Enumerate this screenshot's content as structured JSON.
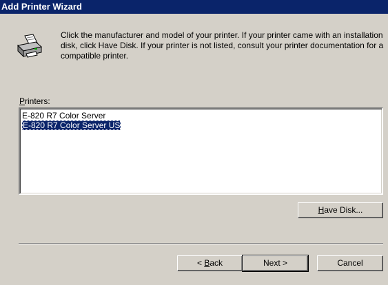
{
  "window": {
    "title": "Add Printer Wizard"
  },
  "instructions": "Click the manufacturer and model of your printer. If your printer came with an installation disk, click Have Disk. If your printer is not listed, consult your printer documentation for a compatible printer.",
  "printers": {
    "label_accel": "P",
    "label_rest": "rinters:",
    "items": [
      "E-820 R7 Color Server",
      "E-820 R7 Color Server US"
    ],
    "selected": "E-820 R7 Color Server US"
  },
  "buttons": {
    "have_disk": {
      "accel": "H",
      "rest": "ave Disk..."
    },
    "back": {
      "prefix": "< ",
      "accel": "B",
      "rest": "ack"
    },
    "next": "Next >",
    "cancel": "Cancel"
  },
  "icons": {
    "printer": "printer-icon"
  },
  "colors": {
    "title_bar": "#0a246a",
    "selection": "#0a246a",
    "face": "#d4d0c8"
  }
}
